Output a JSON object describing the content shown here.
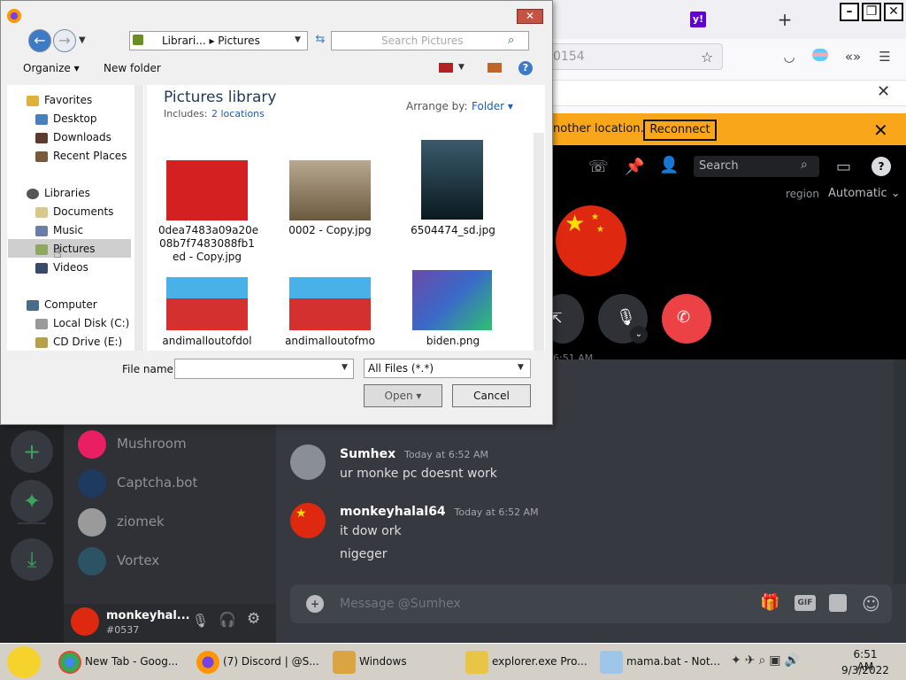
{
  "browser": {
    "url_partial": "0154",
    "notice_text": "nother location.",
    "reconnect_label": "Reconnect",
    "search_placeholder": "Search",
    "region_label": "region",
    "region_value": "Automatic",
    "call_time": "6:51 AM"
  },
  "dialog": {
    "breadcrumb": [
      "Librari...",
      "Pictures"
    ],
    "search_placeholder": "Search Pictures",
    "toolbar": {
      "organize": "Organize",
      "new_folder": "New folder"
    },
    "nav": {
      "favorites": "Favorites",
      "favorite_items": [
        "Desktop",
        "Downloads",
        "Recent Places"
      ],
      "libraries": "Libraries",
      "library_items": [
        "Documents",
        "Music",
        "Pictures",
        "Videos"
      ],
      "computer": "Computer",
      "computer_items": [
        "Local Disk (C:)",
        "CD Drive (E:)"
      ]
    },
    "library_title": "Pictures library",
    "includes_label": "Includes:",
    "includes_value": "2 locations",
    "arrange_label": "Arrange by:",
    "arrange_value": "Folder",
    "files": [
      {
        "name": "0dea7483a09a20e08b7f7483088fb1ed - Copy.jpg",
        "line1": "0dea7483a09a20e",
        "line2": "08b7f7483088fb1",
        "line3": "ed - Copy.jpg"
      },
      {
        "name": "0002 - Copy.jpg",
        "line1": "0002 - Copy.jpg"
      },
      {
        "name": "6504474_sd.jpg",
        "line1": "6504474_sd.jpg"
      },
      {
        "name": "andimalloutofdol...",
        "line1": "andimalloutofdol"
      },
      {
        "name": "andimalloutofmo...",
        "line1": "andimalloutofmo"
      },
      {
        "name": "biden.png",
        "line1": "biden.png"
      }
    ],
    "file_name_label": "File name:",
    "file_type": "All Files (*.*)",
    "open_label": "Open",
    "cancel_label": "Cancel"
  },
  "discord": {
    "dms": [
      "Mushroom",
      "Captcha.bot",
      "ziomek",
      "Vortex"
    ],
    "user": {
      "name": "monkeyhal...",
      "tag": "#0537"
    },
    "messages": [
      {
        "author": "Sumhex",
        "time": "Today at 6:52 AM",
        "lines": [
          "ur monke pc doesnt work"
        ]
      },
      {
        "author": "monkeyhalal64",
        "time": "Today at 6:52 AM",
        "lines": [
          "it dow ork",
          "nigeger"
        ]
      }
    ],
    "message_placeholder": "Message @Sumhex"
  },
  "taskbar": {
    "items": [
      "New Tab - Goog...",
      "(7) Discord | @S...",
      "Windows",
      "explorer.exe Pro...",
      "mama.bat - Not..."
    ],
    "time": "6:51 AM",
    "date": "9/3/2022"
  },
  "colors": {
    "discord_bg": "#36393f",
    "notice": "#faa61a",
    "hangup": "#ed4245",
    "china_red": "#de2910"
  }
}
